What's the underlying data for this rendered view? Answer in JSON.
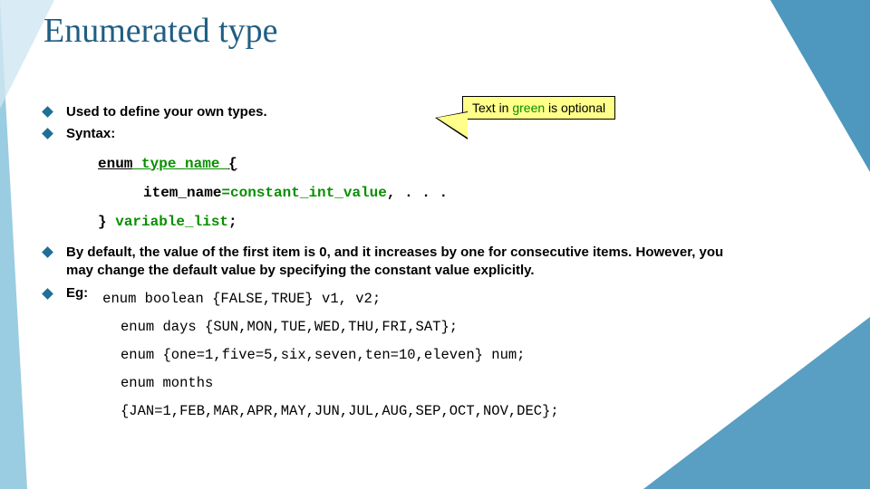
{
  "title": "Enumerated type",
  "bullets": {
    "usedTo": "Used to define your own types.",
    "syntaxLabel": "Syntax:",
    "defaultDesc": "By default, the value of the first item is 0, and it increases by one for consecutive items. However, you may change the default value by specifying the constant value explicitly.",
    "egLabel": "Eg:"
  },
  "callout": {
    "before": "Text in ",
    "green": "green",
    "after": " is optional"
  },
  "syntax": {
    "enumKw": "enum",
    "typeName": " type_name ",
    "openBrace": "{",
    "itemName": "item_name",
    "eqConst": "=constant_int_value",
    "rest": ", . . .",
    "closeBrace": "}",
    "varList": " variable_list",
    "semi": ";"
  },
  "examples": {
    "e1": "enum boolean {FALSE,TRUE} v1, v2;",
    "e2": "enum days {SUN,MON,TUE,WED,THU,FRI,SAT};",
    "e3": "enum {one=1,five=5,six,seven,ten=10,eleven} num;",
    "e4a": "enum months",
    "e4b": "{JAN=1,FEB,MAR,APR,MAY,JUN,JUL,AUG,SEP,OCT,NOV,DEC};"
  }
}
